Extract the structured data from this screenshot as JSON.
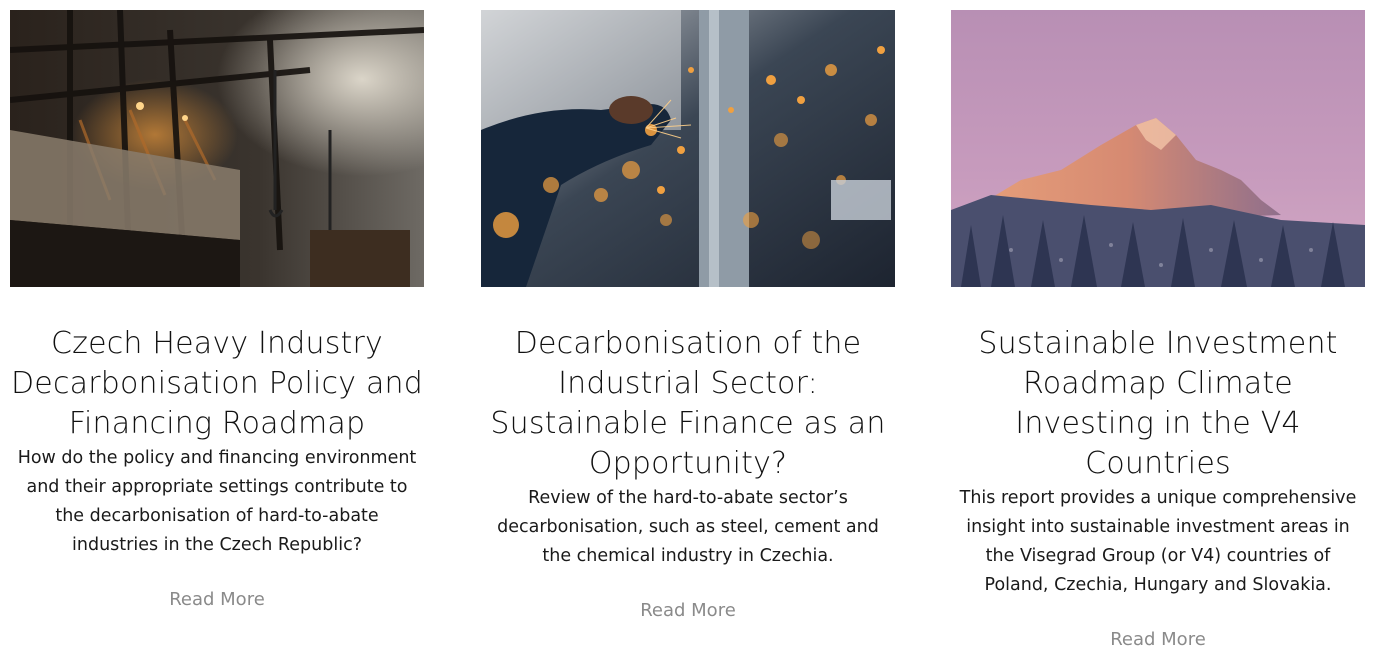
{
  "cards": [
    {
      "image_name": "heavy-industry-factory-image",
      "title": "Czech Heavy Industry Decarbonisation Policy and Financing Roadmap",
      "description": "How do the policy and financing environment and their appropriate settings contribute to the decarbonisation of hard-to-abate industries in the Czech Republic?",
      "link": "Read More"
    },
    {
      "image_name": "welding-sparks-image",
      "title": "Decarbonisation of the Industrial Sector: Sustainable Finance as an Opportunity?",
      "description": "Review of the hard-to-abate sector’s decarbonisation, such as steel, cement and the chemical industry in Czechia.",
      "link": "Read More"
    },
    {
      "image_name": "mountain-sunset-image",
      "title": "Sustainable Investment Roadmap Climate Investing in the V4 Countries",
      "description": "This report provides a unique comprehensive insight into sustainable investment areas in the Visegrad Group (or V4) countries of Poland, Czechia, Hungary and Slovakia.",
      "link": "Read More"
    }
  ],
  "colors": {
    "title": "#111111",
    "body": "#1a1a1a",
    "link": "#8a8a8a"
  }
}
